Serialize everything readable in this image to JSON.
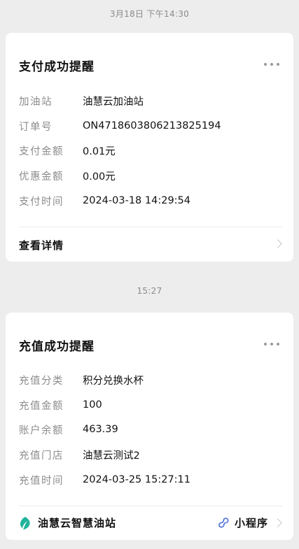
{
  "messages": [
    {
      "timestamp": "3月18日 下午14:30",
      "title": "支付成功提醒",
      "fields": [
        {
          "label": "加油站",
          "value": "油慧云加油站"
        },
        {
          "label": "订单号",
          "value": "ON471860380621382519​4"
        },
        {
          "label": "支付金额",
          "value": "0.01元"
        },
        {
          "label": "优惠金额",
          "value": "0.00元"
        },
        {
          "label": "支付时间",
          "value": "2024-03-18 14:29:54"
        }
      ],
      "footer_label": "查看详情"
    },
    {
      "timestamp": "15:27",
      "title": "充值成功提醒",
      "fields": [
        {
          "label": "充值分类",
          "value": "积分兑换水杯"
        },
        {
          "label": "充值金额",
          "value": "100"
        },
        {
          "label": "账户余额",
          "value": "463.39"
        },
        {
          "label": "充值门店",
          "value": "油慧云测试2"
        },
        {
          "label": "充值时间",
          "value": "2024-03-25 15:27:11"
        }
      ],
      "brand_name": "油慧云智慧油站",
      "mini_program_label": "小程序"
    }
  ],
  "colors": {
    "background": "#ededed",
    "card": "#ffffff",
    "label": "#8c8c8c",
    "brand_icon": "#21b39a",
    "mini_icon": "#5a7be0"
  },
  "icons": {
    "more": "more-dots-icon",
    "chevron": "chevron-right-icon",
    "brand": "leaf-logo-icon",
    "mini_program": "mini-program-link-icon"
  }
}
